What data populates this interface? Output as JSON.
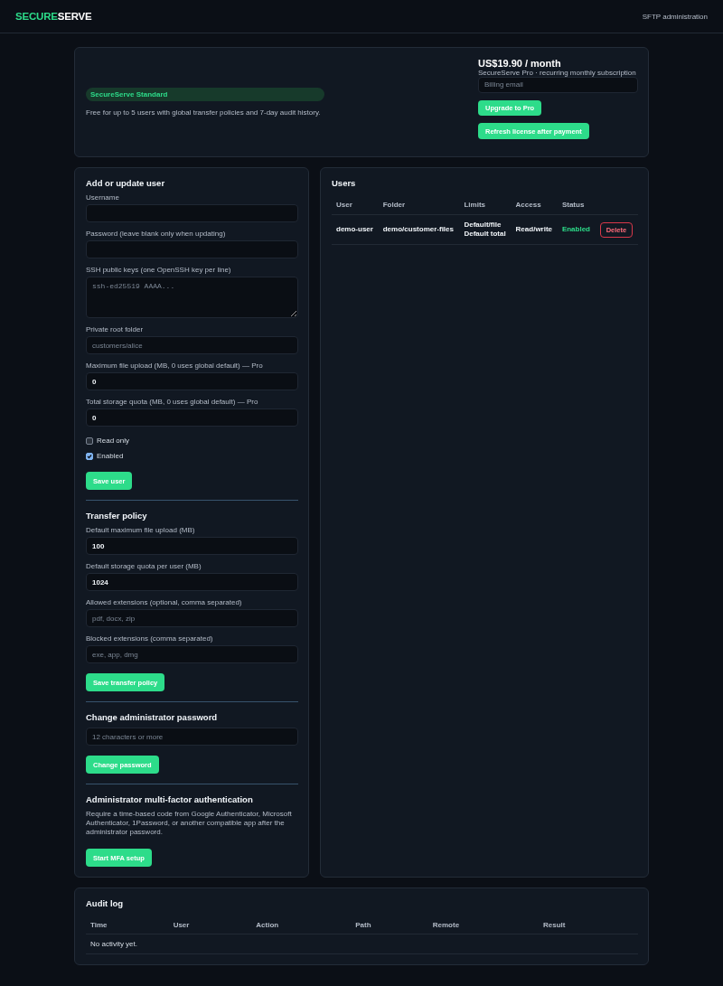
{
  "header": {
    "brand_accent": "SECURE",
    "brand_rest": "SERVE",
    "subtitle": "SFTP administration"
  },
  "license": {
    "plan_badge": "SecureServe Standard",
    "plan_description": "Free for up to 5 users with global transfer policies and 7-day audit history.",
    "price": "US$19.90 / month",
    "price_caption": "SecureServe Pro · recurring monthly subscription",
    "billing_email": {
      "placeholder": "Billing email"
    },
    "buttons": [
      "Upgrade to Pro",
      "Refresh license after payment"
    ]
  },
  "sections": [
    {
      "title": "Add or update user",
      "fields": [
        {
          "kind": "input",
          "label": "Username"
        },
        {
          "kind": "input",
          "label": "Password (leave blank only when updating)"
        },
        {
          "kind": "textarea",
          "label": "SSH public keys (one OpenSSH key per line)",
          "placeholder": "ssh-ed25519 AAAA..."
        },
        {
          "kind": "input",
          "label": "Private root folder",
          "placeholder": "customers/alice"
        },
        {
          "kind": "input",
          "label": "Maximum file upload (MB, 0 uses global default) — Pro",
          "value": "0"
        },
        {
          "kind": "input",
          "label": "Total storage quota (MB, 0 uses global default) — Pro",
          "value": "0"
        }
      ],
      "checkboxes": [
        {
          "label": "Read only",
          "checked": false
        },
        {
          "label": "Enabled",
          "checked": true
        }
      ],
      "submit": "Save user"
    },
    {
      "title": "Transfer policy",
      "fields": [
        {
          "kind": "input",
          "label": "Default maximum file upload (MB)",
          "value": "100"
        },
        {
          "kind": "input",
          "label": "Default storage quota per user (MB)",
          "value": "1024"
        },
        {
          "kind": "input",
          "label": "Allowed extensions (optional, comma separated)",
          "placeholder": "pdf, docx, zip"
        },
        {
          "kind": "input",
          "label": "Blocked extensions (comma separated)",
          "placeholder": "exe, app, dmg"
        }
      ],
      "submit": "Save transfer policy"
    },
    {
      "title": "Change administrator password",
      "fields": [
        {
          "kind": "input",
          "placeholder": "12 characters or more"
        }
      ],
      "submit": "Change password"
    },
    {
      "title": "Administrator multi-factor authentication",
      "description": "Require a time-based code from Google Authenticator, Microsoft Authenticator, 1Password, or another compatible app after the administrator password.",
      "submit": "Start MFA setup"
    }
  ],
  "users": {
    "title": "Users",
    "columns": [
      "User",
      "Folder",
      "Limits",
      "Access",
      "Status"
    ],
    "rows": [
      {
        "user": "demo-user",
        "folder": "demo/customer-files",
        "limits": [
          "Default/file",
          "Default total"
        ],
        "access": "Read/write",
        "status": "Enabled",
        "enabled": true,
        "action": "Delete"
      }
    ]
  },
  "audit_log": {
    "title": "Audit log",
    "columns": [
      "Time",
      "User",
      "Action",
      "Path",
      "Remote",
      "Result"
    ],
    "empty_message": "No activity yet."
  }
}
